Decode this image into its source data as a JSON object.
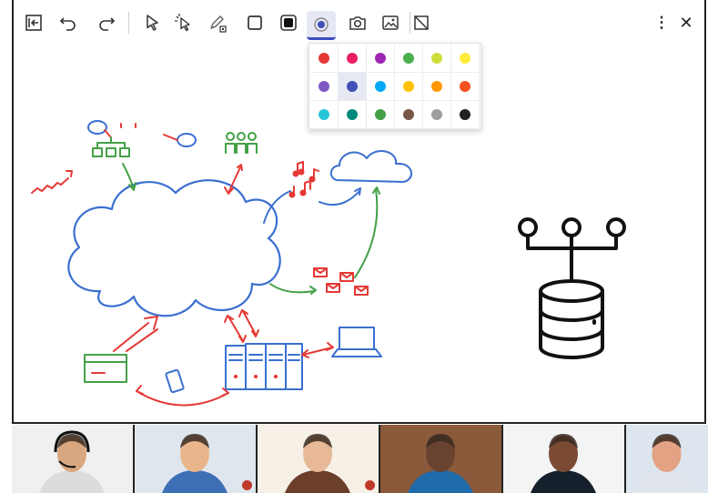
{
  "toolbar": {
    "left_tools": [
      {
        "name": "exit-panel-icon"
      },
      {
        "name": "undo-icon"
      },
      {
        "name": "redo-icon"
      },
      {
        "name": "select-pointer-icon"
      },
      {
        "name": "laser-pointer-icon"
      },
      {
        "name": "pen-icon"
      },
      {
        "name": "shape-square-icon"
      },
      {
        "name": "fill-square-icon"
      },
      {
        "name": "color-picker-icon",
        "active": true
      },
      {
        "name": "camera-icon"
      },
      {
        "name": "image-icon"
      },
      {
        "name": "clear-canvas-icon"
      }
    ],
    "right_tools": [
      {
        "name": "more-options-icon",
        "glyph": "⋮"
      },
      {
        "name": "close-icon",
        "glyph": "✕"
      }
    ]
  },
  "palette": {
    "selected": "#3f51b5",
    "colors": [
      "#e53935",
      "#e91e63",
      "#9c27b0",
      "#4caf50",
      "#cddc39",
      "#ffeb3b",
      "#7e57c2",
      "#3f51b5",
      "#03a9f4",
      "#ffc107",
      "#ff9800",
      "#f4511e",
      "#26c6da",
      "#00897b",
      "#43a047",
      "#795548",
      "#9e9e9e",
      "#212121"
    ]
  },
  "accent_color": "#3b4cc0",
  "participants": [
    {
      "name": "participant-1",
      "skin": "#d9a77f",
      "shirt": "#dcdcdc",
      "bg": "#f0f0f0",
      "headset": true,
      "muted": false
    },
    {
      "name": "participant-2",
      "skin": "#e9b58c",
      "shirt": "#3d6fb5",
      "bg": "#dfe6ee",
      "headset": false,
      "muted": true
    },
    {
      "name": "participant-3",
      "skin": "#e7b996",
      "shirt": "#6b3f2a",
      "bg": "#f6f0e6",
      "headset": false,
      "muted": true
    },
    {
      "name": "participant-4",
      "skin": "#6a4330",
      "shirt": "#1f6aa8",
      "bg": "#8b5a3a",
      "headset": false,
      "muted": false
    },
    {
      "name": "participant-5",
      "skin": "#7a4a33",
      "shirt": "#16202c",
      "bg": "#f4f4f4",
      "headset": false,
      "muted": false
    },
    {
      "name": "participant-6",
      "skin": "#e3a283",
      "shirt": "#dfe4ea",
      "bg": "#dde6ee",
      "headset": false,
      "muted": false
    }
  ]
}
